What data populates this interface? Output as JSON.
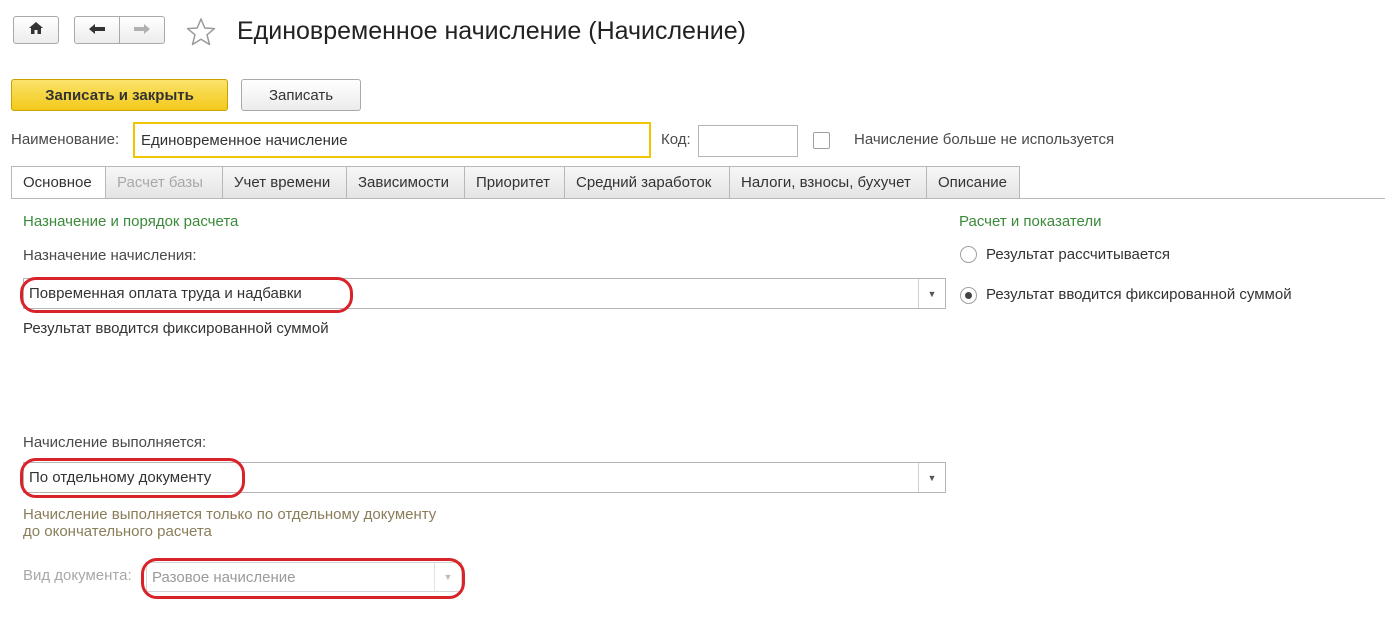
{
  "window": {
    "title": "Единовременное начисление (Начисление)"
  },
  "nav": {
    "home_icon": "home-icon",
    "back_icon": "arrow-left-icon",
    "forward_icon": "arrow-right-icon",
    "favorite_icon": "star-icon"
  },
  "toolbar": {
    "save_close_label": "Записать и закрыть",
    "save_label": "Записать"
  },
  "form": {
    "name_label": "Наименование:",
    "name_value": "Единовременное начисление",
    "code_label": "Код:",
    "code_value": "",
    "unused_label": "Начисление больше не используется"
  },
  "tabs": [
    {
      "label": "Основное",
      "active": true
    },
    {
      "label": "Расчет базы",
      "disabled": true
    },
    {
      "label": "Учет времени"
    },
    {
      "label": "Зависимости"
    },
    {
      "label": "Приоритет"
    },
    {
      "label": "Средний заработок"
    },
    {
      "label": "Налоги, взносы, бухучет"
    },
    {
      "label": "Описание"
    }
  ],
  "main": {
    "section_title": "Назначение и порядок расчета",
    "purpose_label": "Назначение начисления:",
    "purpose_value": "Повременная оплата труда и надбавки",
    "purpose_note": "Результат вводится фиксированной суммой",
    "execution_label": "Начисление выполняется:",
    "execution_value": "По отдельному документу",
    "execution_note_line1": "Начисление выполняется только по отдельному документу",
    "execution_note_line2": "до окончательного расчета",
    "doc_type_label": "Вид документа:",
    "doc_type_value": "Разовое начисление"
  },
  "right": {
    "section_title": "Расчет и показатели",
    "radio_calculated": "Результат рассчитывается",
    "radio_fixed": "Результат вводится фиксированной суммой",
    "selected": "fixed"
  },
  "colors": {
    "accent_yellow": "#f3c91b",
    "section_green": "#3b8a3b",
    "highlight_red": "#d9232a",
    "note_olive": "#8a7d5a"
  }
}
